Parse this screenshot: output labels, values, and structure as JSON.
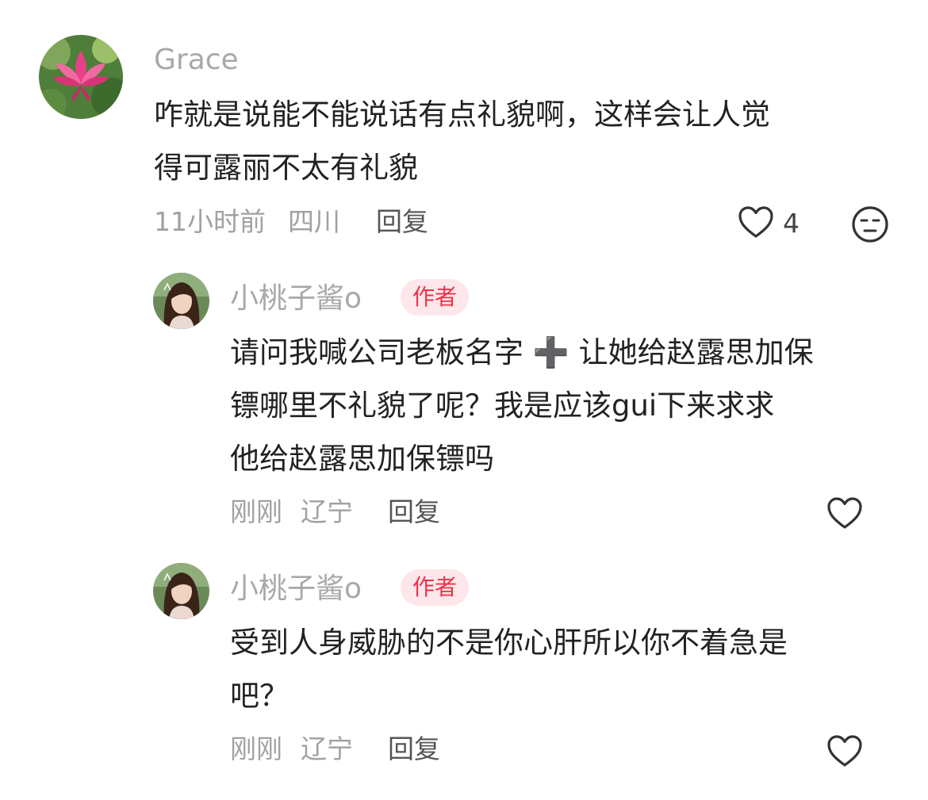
{
  "comment": {
    "username": "Grace",
    "text_lines": [
      "咋就是说能不能说话有点礼貌啊，这样会让人觉",
      "得可露丽不太有礼貌"
    ],
    "time": "11小时前",
    "location": "四川",
    "reply_label": "回复",
    "like_count": "4",
    "like_icon": "heart-outline-icon",
    "dislike_icon": "unamused-face-icon"
  },
  "replies": [
    {
      "username": "小桃子酱o",
      "badge": "作者",
      "text_lines": [
        "请问我喊公司老板名字 ➕ 让她给赵露思加保",
        "镖哪里不礼貌了呢？我是应该gui下来求求",
        "他给赵露思加保镖吗"
      ],
      "time": "刚刚",
      "location": "辽宁",
      "reply_label": "回复",
      "like_icon": "heart-outline-icon"
    },
    {
      "username": "小桃子酱o",
      "badge": "作者",
      "text_lines": [
        "受到人身威胁的不是你心肝所以你不着急是",
        "吧？"
      ],
      "time": "刚刚",
      "location": "辽宁",
      "reply_label": "回复",
      "like_icon": "heart-outline-icon"
    }
  ],
  "colors": {
    "badge_text": "#f0304a",
    "badge_bg": "#fde7ea",
    "meta_text": "#a1a1a1"
  }
}
